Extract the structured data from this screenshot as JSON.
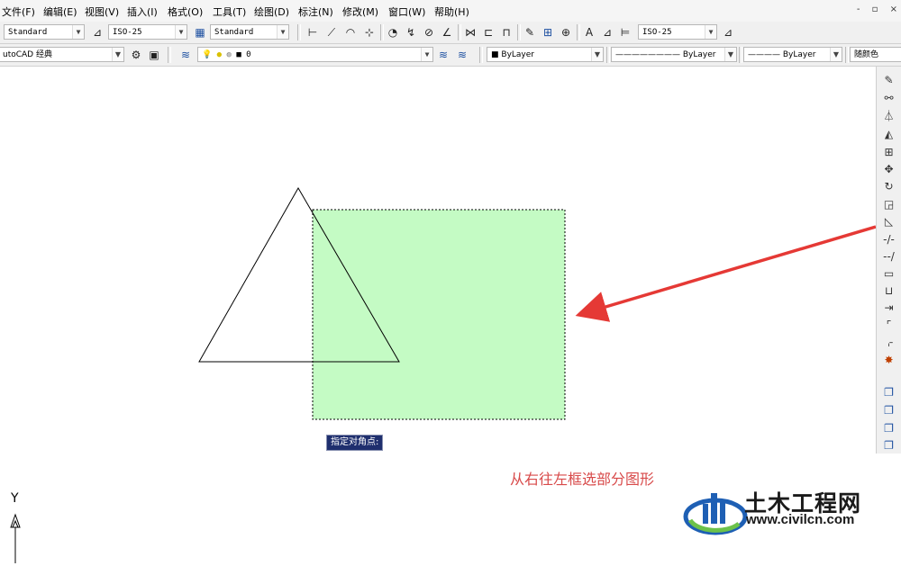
{
  "menubar": {
    "items": [
      "文件(F)",
      "编辑(E)",
      "视图(V)",
      "插入(I)",
      "格式(O)",
      "工具(T)",
      "绘图(D)",
      "标注(N)",
      "修改(M)",
      "窗口(W)",
      "帮助(H)"
    ],
    "window_controls": [
      "-",
      "▫",
      "×"
    ]
  },
  "toolbar1": {
    "text_style": "Standard",
    "dim_style": "ISO-25",
    "table_style": "Standard",
    "mleader_style": "ISO-25"
  },
  "toolbar2": {
    "workspace": "utoCAD 经典",
    "layer": "0",
    "color": "ByLayer",
    "linetype": "ByLayer",
    "lineweight": "ByLayer",
    "plotstyle": "随颜色"
  },
  "tooltip": {
    "text": "指定对角点:"
  },
  "caption": {
    "text": "从右往左框选部分图形"
  },
  "ucs": {
    "y_label": "Y"
  },
  "watermark": {
    "name": "土木工程网",
    "url": "www.civilcn.com"
  },
  "colors": {
    "selection_fill": "#c4fbc4",
    "arrow": "#e53935",
    "caption": "#d84a4a",
    "tooltip_bg": "#1f2f6e",
    "logo_blue": "#1e5fb4",
    "logo_green": "#6cc24a"
  },
  "icons": {
    "toolbar1": [
      "text-style-icon",
      "dim-style-icon",
      "table-style-icon",
      "linear-dim-icon",
      "aligned-dim-icon",
      "arc-length-icon",
      "ordinate-icon",
      "radius-icon",
      "jogged-icon",
      "diameter-icon",
      "angular-icon",
      "quick-dim-icon",
      "baseline-icon",
      "continue-icon",
      "tolerance-icon",
      "center-mark-icon",
      "dim-edit-icon",
      "dim-text-edit-icon",
      "dim-update-icon",
      "mleader-style-icon"
    ],
    "toolbar2": [
      "workspace-settings-icon",
      "workspace-save-icon",
      "layer-manager-icon",
      "layer-on-icon",
      "layer-freeze-icon",
      "layer-lock-icon",
      "layer-color-icon",
      "make-current-icon",
      "layer-previous-icon"
    ],
    "right": [
      "erase-icon",
      "copy-icon",
      "mirror-icon",
      "offset-icon",
      "array-icon",
      "move-icon",
      "rotate-icon",
      "scale-icon",
      "stretch-icon",
      "trim-icon",
      "extend-icon",
      "break-at-point-icon",
      "break-icon",
      "join-icon",
      "chamfer-icon",
      "fillet-icon",
      "explode-icon",
      "draworder-front-icon",
      "draworder-back-icon",
      "draworder-above-icon",
      "draworder-under-icon"
    ]
  }
}
